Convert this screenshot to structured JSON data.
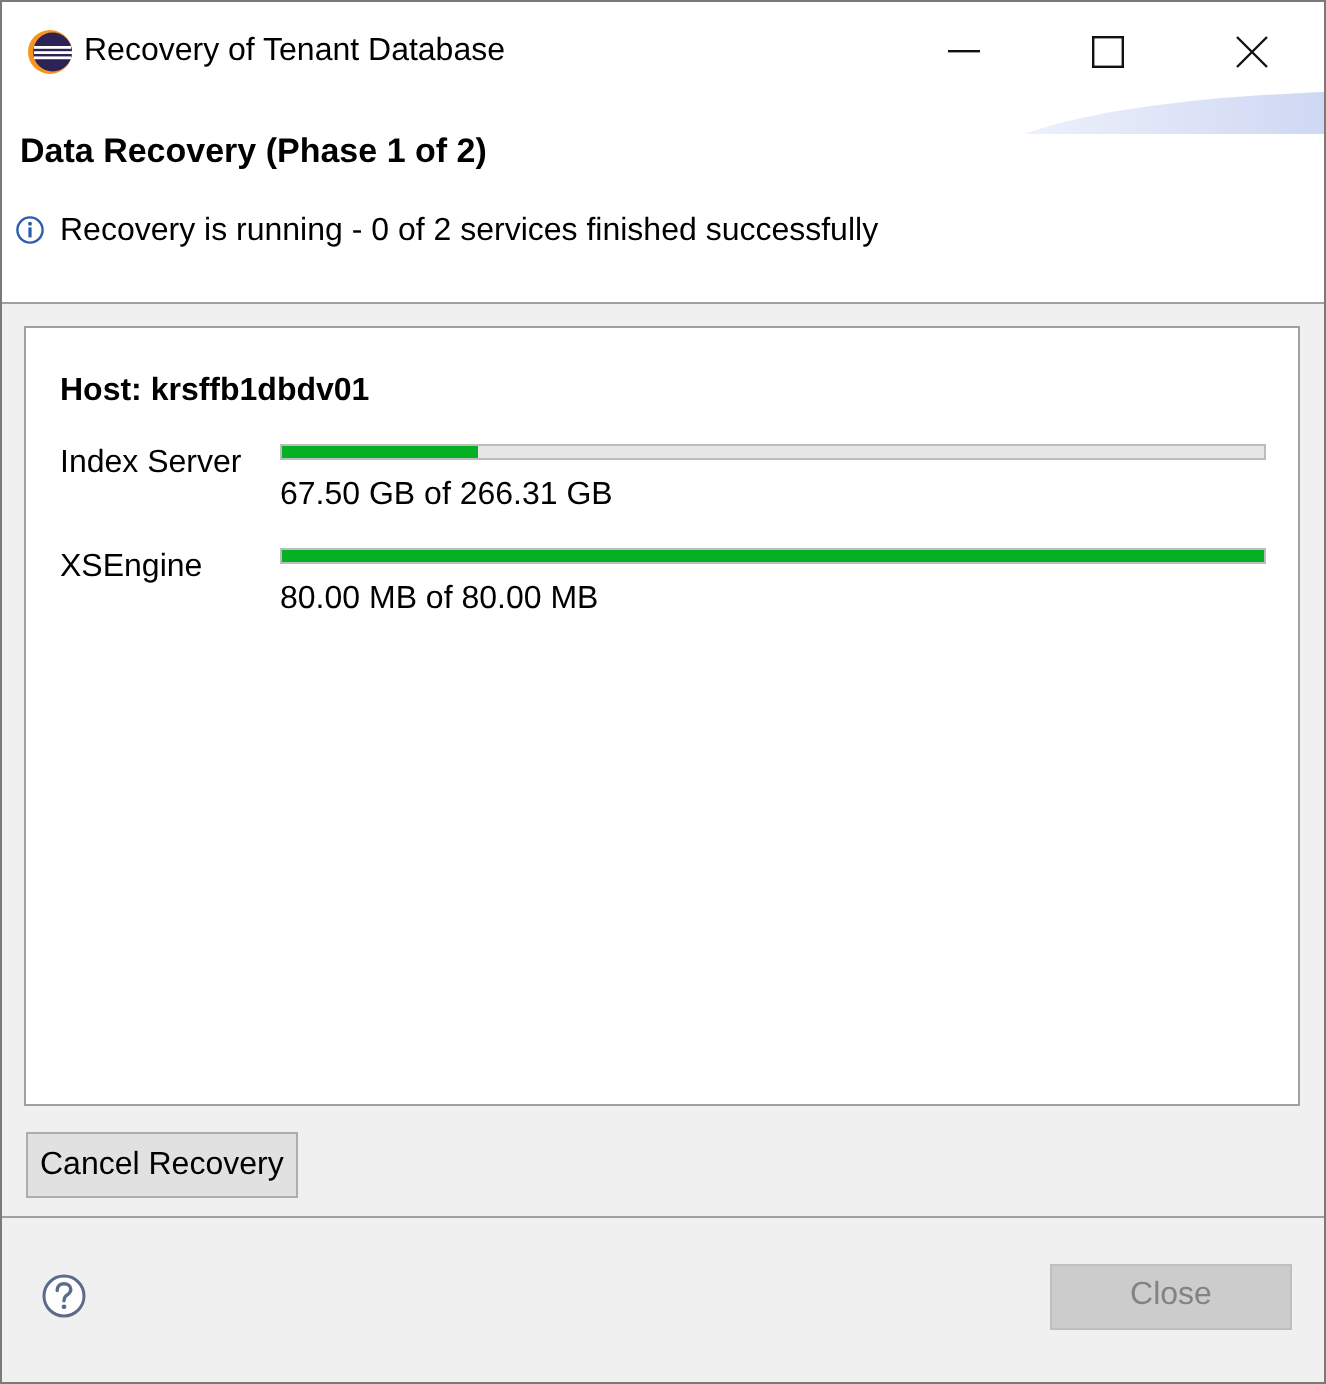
{
  "window": {
    "title": "Recovery of Tenant Database"
  },
  "header": {
    "title": "Data Recovery (Phase 1 of 2)",
    "message": {
      "kind": "info",
      "text": "Recovery is running - 0 of 2 services finished successfully"
    }
  },
  "host": {
    "label": "Host: krsffb1dbdv01"
  },
  "services": [
    {
      "name": "Index Server",
      "level": 0.2,
      "reading": "67.50 GB of 266.31 GB"
    },
    {
      "name": "XSEngine",
      "level": 1,
      "reading": "80.00 MB of 80.00 MB"
    }
  ],
  "actions": [
    {
      "label": "Cancel Recovery",
      "disabled": false
    }
  ],
  "footer_buttons": [
    {
      "label": "Close",
      "disabled": true
    }
  ]
}
